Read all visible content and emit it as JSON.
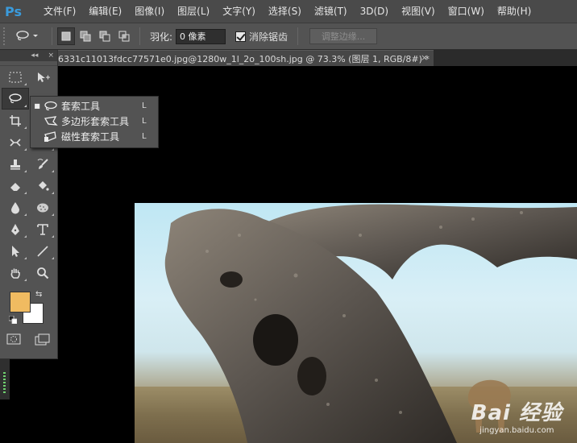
{
  "app": {
    "logo": "Ps"
  },
  "menu": [
    "文件(F)",
    "编辑(E)",
    "图像(I)",
    "图层(L)",
    "文字(Y)",
    "选择(S)",
    "滤镜(T)",
    "3D(D)",
    "视图(V)",
    "窗口(W)",
    "帮助(H)"
  ],
  "options": {
    "feather_label": "羽化:",
    "feather_value": "0 像素",
    "antialias_label": "消除锯齿",
    "antialias_checked": true,
    "refine_edge": "调整边缘..."
  },
  "document": {
    "tab_title": "6331c11013fdcc77571e0.jpg@1280w_1l_2o_100sh.jpg @ 73.3% (图层 1, RGB/8#) *",
    "close": "×"
  },
  "toolbox": {
    "collapse": "◂◂",
    "close": "×",
    "foreground_color": "#f0bb61",
    "background_color": "#ffffff"
  },
  "flyout": {
    "items": [
      {
        "label": "套索工具",
        "shortcut": "L",
        "active": true,
        "icon": "lasso-icon"
      },
      {
        "label": "多边形套索工具",
        "shortcut": "L",
        "active": false,
        "icon": "polygonal-lasso-icon"
      },
      {
        "label": "磁性套索工具",
        "shortcut": "L",
        "active": false,
        "icon": "magnetic-lasso-icon"
      }
    ]
  },
  "watermark": {
    "main": "Bai 经验",
    "sub": "jingyan.baidu.com"
  },
  "colors": {
    "menubar": "#4a4a4a",
    "panel": "#535353",
    "canvas": "#000000",
    "accent": "#3a9bdc"
  }
}
